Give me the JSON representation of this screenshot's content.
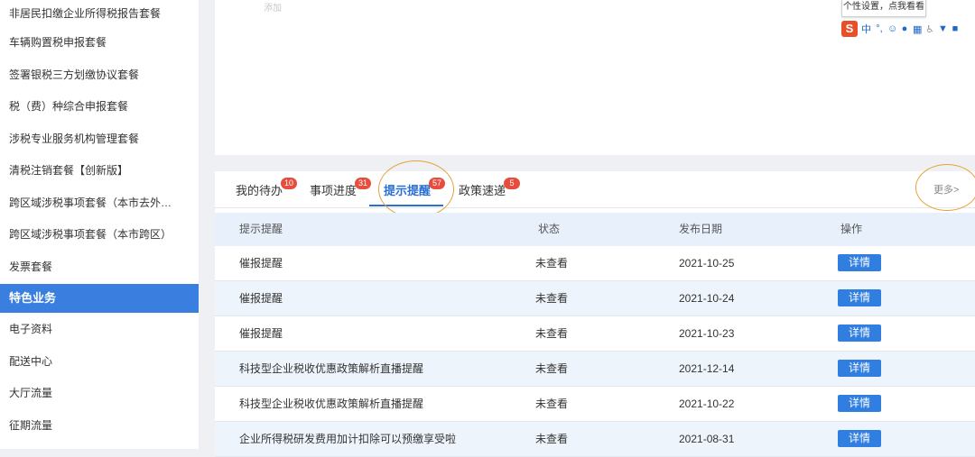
{
  "sidebar": {
    "items": [
      {
        "label": "非居民扣缴企业所得税报告套餐"
      },
      {
        "label": "车辆购置税申报套餐"
      },
      {
        "label": "签署银税三方划缴协议套餐"
      },
      {
        "label": "税（费）种综合申报套餐"
      },
      {
        "label": "涉税专业服务机构管理套餐"
      },
      {
        "label": "清税注销套餐【创新版】"
      },
      {
        "label": "跨区域涉税事项套餐（本市去外…"
      },
      {
        "label": "跨区域涉税事项套餐（本市跨区）"
      },
      {
        "label": "发票套餐"
      },
      {
        "label": "特色业务"
      },
      {
        "label": "电子资料"
      },
      {
        "label": "配送中心"
      },
      {
        "label": "大厅流量"
      },
      {
        "label": "征期流量"
      }
    ]
  },
  "top": {
    "faint_text": "添加",
    "tooltip": "个性设置，点我看看",
    "ime_logo": "S",
    "ime_lang": "中"
  },
  "tabs": [
    {
      "label": "我的待办",
      "count": "10"
    },
    {
      "label": "事项进度",
      "count": "31"
    },
    {
      "label": "提示提醒",
      "count": "57"
    },
    {
      "label": "政策速递",
      "count": "5"
    }
  ],
  "more_label": "更多>",
  "table": {
    "headers": [
      "提示提醒",
      "状态",
      "发布日期",
      "操作"
    ],
    "rows": [
      {
        "title": "催报提醒",
        "status": "未查看",
        "date": "2021-10-25",
        "action": "详情"
      },
      {
        "title": "催报提醒",
        "status": "未查看",
        "date": "2021-10-24",
        "action": "详情"
      },
      {
        "title": "催报提醒",
        "status": "未查看",
        "date": "2021-10-23",
        "action": "详情"
      },
      {
        "title": "科技型企业税收优惠政策解析直播提醒",
        "status": "未查看",
        "date": "2021-12-14",
        "action": "详情"
      },
      {
        "title": "科技型企业税收优惠政策解析直播提醒",
        "status": "未查看",
        "date": "2021-10-22",
        "action": "详情"
      },
      {
        "title": "企业所得税研发费用加计扣除可以预缴享受啦",
        "status": "未查看",
        "date": "2021-08-31",
        "action": "详情"
      }
    ]
  },
  "colors": {
    "accent": "#2a6fd6",
    "sidebar_active": "#3a7fe0",
    "badge": "#e74c3c",
    "annotation_circle": "#e6a23c"
  }
}
